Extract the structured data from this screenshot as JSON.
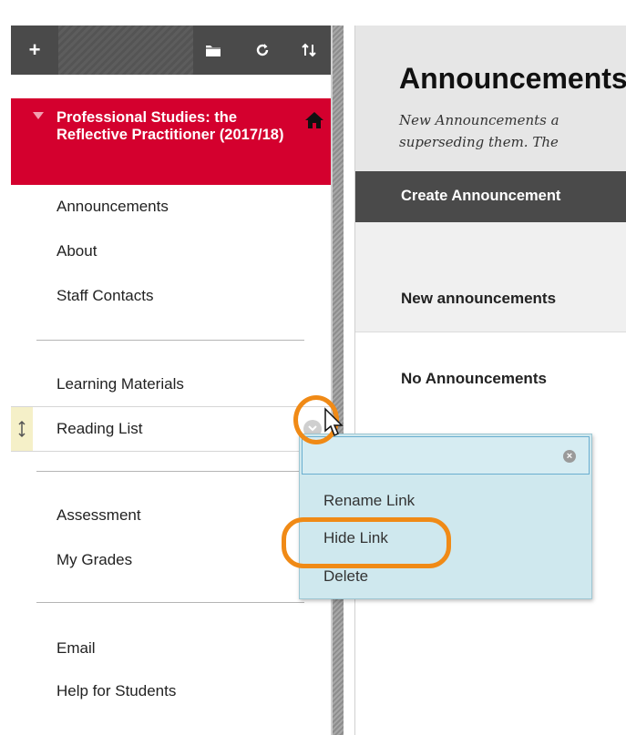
{
  "toolbar": {
    "add_label": "+",
    "icons": [
      "folder-icon",
      "refresh-icon",
      "sort-icon"
    ]
  },
  "course": {
    "title": "Professional Studies: the Reflective Practitioner (2017/18)"
  },
  "menu": {
    "group1": [
      "Announcements",
      "About",
      "Staff Contacts"
    ],
    "group2": [
      "Learning Materials",
      "Reading List"
    ],
    "group3": [
      "Assessment",
      "My Grades"
    ],
    "group4": [
      "Email",
      "Help for Students"
    ]
  },
  "context_menu": {
    "search_value": "",
    "items": [
      "Rename Link",
      "Hide Link",
      "Delete"
    ]
  },
  "content": {
    "title": "Announcements",
    "instructions_line1": "New Announcements a",
    "instructions_line2": "superseding them. The",
    "create_button": "Create Announcement",
    "filter_label": "New announcements",
    "empty_message": "No Announcements"
  },
  "colors": {
    "accent": "#d4002e",
    "highlight": "#f08a16",
    "toolbar": "#4a4a4a",
    "menu_bg": "#cfe8ee"
  }
}
